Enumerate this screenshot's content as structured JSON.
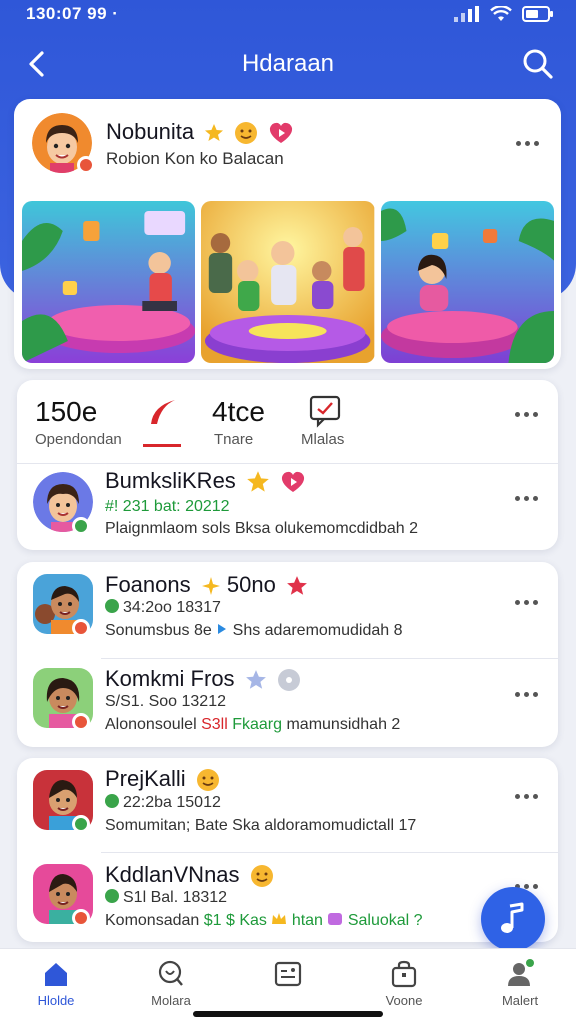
{
  "status": {
    "time": "130:07 99 ·"
  },
  "header": {
    "title": "Hdaraan"
  },
  "feature": {
    "name": "Nobunita",
    "subtitle": "Robion Kon ko Balacan"
  },
  "stats": {
    "first_value": "150e",
    "first_label": "Opendondan",
    "third_value": "4tce",
    "third_label": "Tnare",
    "fourth_label": "Mlalas"
  },
  "items": [
    {
      "name": "BumksliKRes",
      "meta": "#! 231 bat: 20212",
      "desc": "Plaignmlaom sols Bksa olukemomcdidbah 2"
    },
    {
      "name": "Foanons",
      "name_suffix": "50no",
      "meta": "34:2oo 18317",
      "desc_pre": "Sonumsbus 8e",
      "desc_post": "Shs adaremomudidah 8"
    },
    {
      "name": "Komkmi Fros",
      "meta": "S/S1. Soo 13212",
      "desc_pre": "Alononsoulel",
      "desc_red": "S3ll",
      "desc_green": "Fkaarg",
      "desc_post": "mamunsidhah 2"
    },
    {
      "name": "PrejKalli",
      "meta": "22:2ba 15012",
      "desc": "Somumitan; Bate Ska aldoramomudictall 17"
    },
    {
      "name": "KddlanVNnas",
      "meta": "S1l Bal. 18312",
      "desc_pre": "Komonsadan",
      "desc_green_1": "$1 $ Kas",
      "desc_green_2": "htan",
      "desc_green_3": "Saluokal ?"
    }
  ],
  "tabs": [
    {
      "label": "Hlolde",
      "icon": "home-icon"
    },
    {
      "label": "Molara",
      "icon": "search-circle-icon"
    },
    {
      "label": "",
      "icon": "card-icon"
    },
    {
      "label": "Voone",
      "icon": "bag-icon"
    },
    {
      "label": "Malert",
      "icon": "profile-icon"
    }
  ],
  "colors": {
    "primary": "#2f57d8",
    "fab": "#2f62e6",
    "online": "#3aa44a",
    "badge": "#e8553a"
  }
}
